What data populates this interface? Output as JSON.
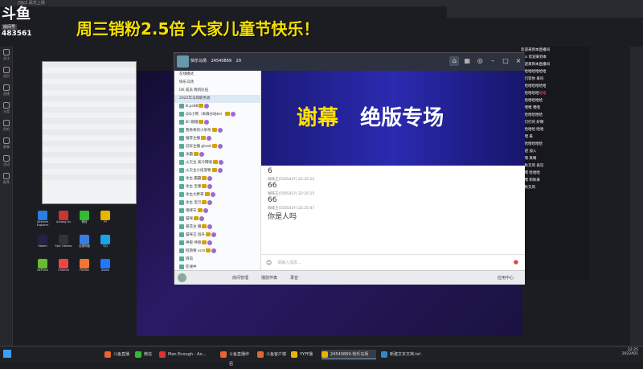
{
  "stream": {
    "topbar_text": "[9](2 武式上场",
    "logo": "斗鱼",
    "room_label": "房间号",
    "room_number": "483561",
    "marquee": "周三销粉2.5倍 大家儿童节快乐！"
  },
  "left_toolbar": [
    "关注",
    "首页",
    "直播",
    "分类",
    "鱼吧",
    "赛事",
    "活动",
    "推荐"
  ],
  "desktop_icons": [
    {
      "label": "Internet Explorer",
      "color": "#2a7de1"
    },
    {
      "label": "Among Us",
      "color": "#c33"
    },
    {
      "label": "微信",
      "color": "#3b3"
    },
    {
      "label": "YY",
      "color": "#e9b400"
    },
    {
      "label": "Steam",
      "color": "#224"
    },
    {
      "label": "Epic Games",
      "color": "#333"
    },
    {
      "label": "百度网盘",
      "color": "#3a7de0"
    },
    {
      "label": "QQ",
      "color": "#1aa3e8"
    },
    {
      "label": "GeForce",
      "color": "#6b3"
    },
    {
      "label": "Chrome",
      "color": "#e44"
    },
    {
      "label": "Firefox",
      "color": "#e73"
    },
    {
      "label": "Zoom",
      "color": "#27f"
    }
  ],
  "chat_window": {
    "title": "快乐马场",
    "group_id": "24540869",
    "member_count": "20",
    "member_list": [
      "在线模式",
      "快乐马场",
      "DK 成员·我的队伍",
      "2022年马场职务会",
      "B.ps88",
      "QQ小熊（本群分站ke）",
      "B! 蹭蹭",
      "我秀秀的小杀杀",
      "推荐主播",
      "冠军主播 ghost",
      "冰霸",
      "火灾主 高冷网咖",
      "火灾主小炫宠物",
      "冰主 霸霸",
      "冰主 至尊",
      "冰主大胖哥",
      "冰主 宝贝",
      "咆哮天",
      "猫咪",
      "菊花主 播",
      "猫咪王 恒升",
      "神兽 神兽",
      "阿斯顿 xcm",
      "目前",
      "在线中"
    ],
    "banner_yellow": "谢幕",
    "banner_white": "绝版专场",
    "messages": [
      {
        "name": "",
        "text": "6"
      },
      {
        "name": "咖啡王(556543?)  22:25:12",
        "text": "66"
      },
      {
        "name": "咖啡王(556543?)  22:25:15",
        "text": "66"
      },
      {
        "name": "咖啡王(556543?)  22:25:47",
        "text": "你是人吗"
      }
    ],
    "input_placeholder": "请输入消息...",
    "bottom_items": [
      "房间管理",
      "播放伴奏",
      "录音"
    ],
    "bottom_right": "应用中心"
  },
  "right_chat": [
    {
      "n": "欢迎来到本直播间",
      "m": ""
    },
    {
      "n": "Oss 欢迎来到本",
      "m": ""
    },
    {
      "n": "欢迎来到本直播间",
      "m": ""
    },
    {
      "n": "哈哈哈哈哈哈哈",
      "m": ""
    },
    {
      "n": "我们等你 来吗",
      "m": ""
    },
    {
      "n": "哈哈哈哈哈哈哈",
      "m": ""
    },
    {
      "n": "哈哈哈哈哈",
      "m": "哈哈"
    },
    {
      "n": "哈哈哈哈哈哈",
      "m": ""
    },
    {
      "n": "嘿嘿嘿 嘿嘿",
      "m": ""
    },
    {
      "n": "哈哈哈哈哈哈",
      "m": ""
    },
    {
      "n": "你们打的 好啊",
      "m": ""
    },
    {
      "n": "哈哈哈哈 哈哈",
      "m": ""
    },
    {
      "n": "嘿嘿 来",
      "m": ""
    },
    {
      "n": "哈哈哈哈哈哈",
      "m": ""
    },
    {
      "n": "欢迎 加入",
      "m": ""
    },
    {
      "n": "嘿嘿 来啊",
      "m": ""
    },
    {
      "n": "和秋叉风 再见",
      "m": ""
    },
    {
      "n": "嘿嘿 哈哈哈",
      "m": ""
    },
    {
      "n": "嘿嘿 和秋来",
      "m": ""
    },
    {
      "n": "和秋叉风",
      "m": ""
    }
  ],
  "taskbar": [
    {
      "label": "斗鱼直播",
      "color": "#e6662f",
      "on": false
    },
    {
      "label": "微信",
      "color": "#3b3",
      "on": false
    },
    {
      "label": "Man Enough - An...",
      "color": "#d33",
      "on": false
    },
    {
      "label": "斗鱼直播伴侣",
      "color": "#e6662f",
      "on": false
    },
    {
      "label": "斗鱼客户端",
      "color": "#e6662f",
      "on": false
    },
    {
      "label": "YY开播",
      "color": "#e9b400",
      "on": false
    },
    {
      "label": "24540869-快乐马场",
      "color": "#e9b400",
      "on": true
    },
    {
      "label": "新建文本文档.txt",
      "color": "#38c",
      "on": false
    }
  ],
  "clock": {
    "time": "22:25",
    "date": "2022/6/1"
  },
  "colors": {
    "marquee": "#f3e000",
    "banner": "#ffe100"
  }
}
